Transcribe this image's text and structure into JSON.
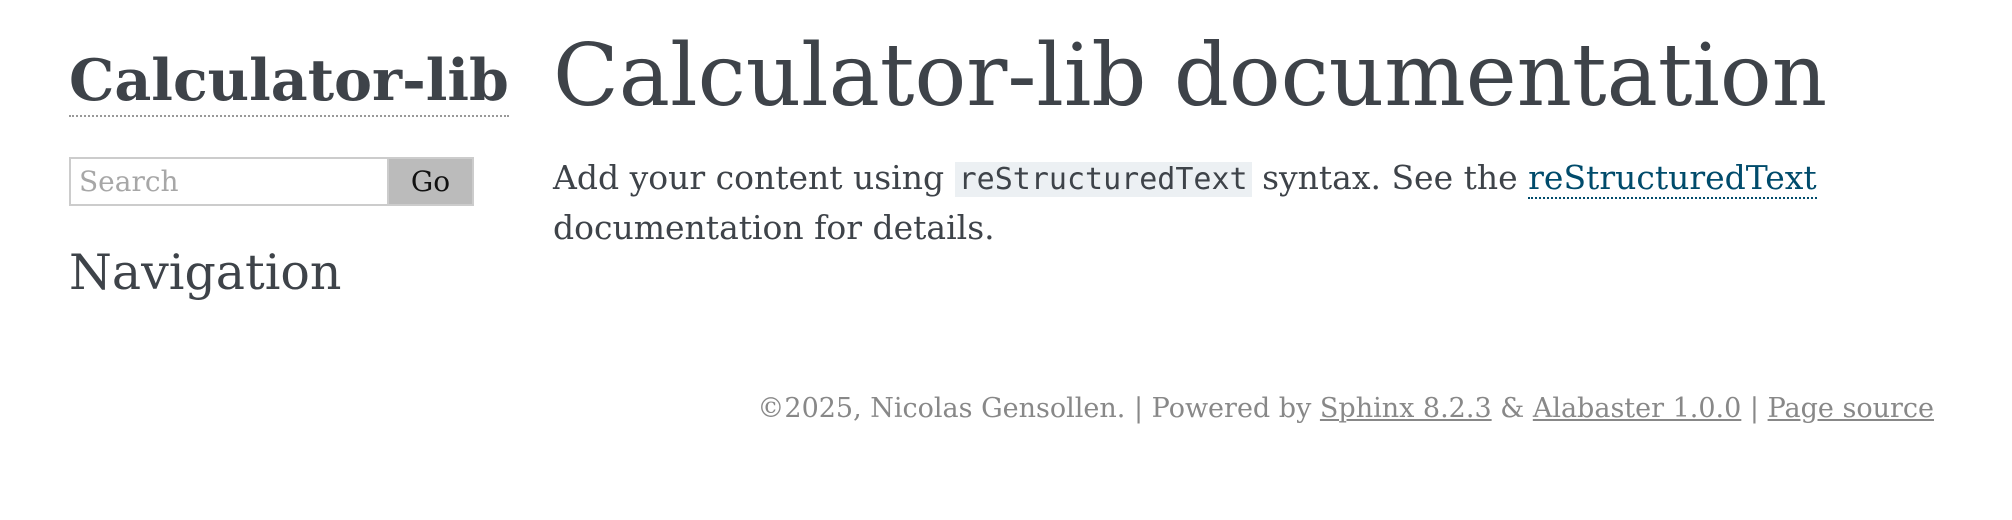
{
  "sidebar": {
    "logo": "Calculator-lib",
    "search": {
      "placeholder": "Search",
      "value": "",
      "button_label": "Go"
    },
    "navigation_heading": "Navigation"
  },
  "main": {
    "title": "Calculator-lib documentation",
    "paragraph": {
      "text_1": "Add your content using ",
      "code": "reStructuredText",
      "text_2": " syntax. See the ",
      "link": "reStructuredText",
      "text_3": " documen­tation for details."
    }
  },
  "footer": {
    "copyright": "©2025, Nicolas Gensollen.",
    "separator_1": " | Powered by ",
    "sphinx_link": "Sphinx 8.2.3",
    "ampersand": " & ",
    "alabaster_link": "Alabaster 1.0.0",
    "separator_2": " | ",
    "page_source_link": "Page source"
  },
  "colors": {
    "text": "#3e4349",
    "link": "#004b6b",
    "footer": "#888888",
    "code_background": "#ecf0f3",
    "button_background": "#bbbbbb"
  }
}
